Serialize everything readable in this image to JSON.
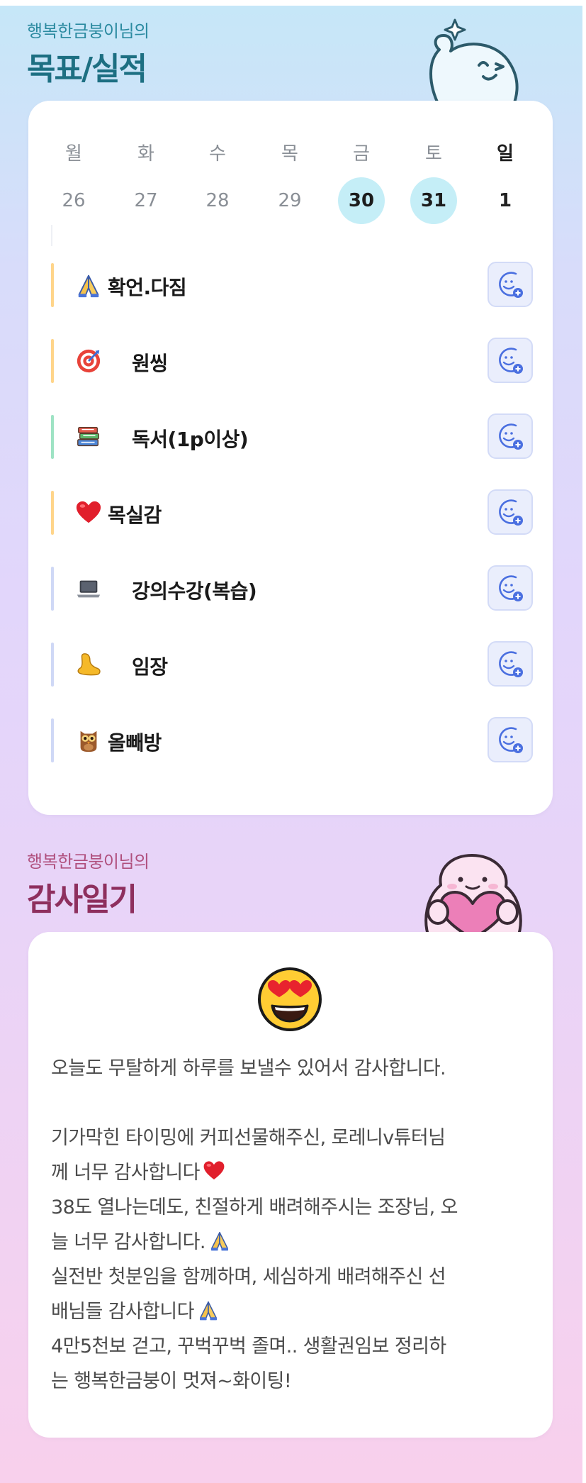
{
  "goal_section": {
    "subtitle": "행복한금붕이님의",
    "title": "목표/실적"
  },
  "calendar": {
    "weekdays": [
      "월",
      "화",
      "수",
      "목",
      "금",
      "토",
      "일"
    ],
    "dates": [
      "26",
      "27",
      "28",
      "29",
      "30",
      "31",
      "1"
    ],
    "highlighted_dates": [
      "30",
      "31"
    ]
  },
  "habits": [
    {
      "icon": "praying-hands-icon",
      "label": "확언.다짐",
      "bar_color": "#ffd58a"
    },
    {
      "icon": "target-icon",
      "label": "원씽",
      "bar_color": "#ffd58a"
    },
    {
      "icon": "books-icon",
      "label": "독서(1p이상)",
      "bar_color": "#9ee3c4"
    },
    {
      "icon": "heart-icon",
      "label": "목실감",
      "bar_color": "#ffd58a"
    },
    {
      "icon": "laptop-icon",
      "label": "강의수강(복습)",
      "bar_color": "#cfd8f6"
    },
    {
      "icon": "foot-icon",
      "label": "임장",
      "bar_color": "#cfd8f6"
    },
    {
      "icon": "owl-icon",
      "label": "올빼방",
      "bar_color": "#cfd8f6"
    }
  ],
  "diary_section": {
    "subtitle": "행복한금붕이님의",
    "title": "감사일기"
  },
  "diary": {
    "mood_icon": "heart-eyes-face-icon",
    "lines": [
      "오늘도 무탈하게 하루를 보낼수 있어서 감사합니다.",
      "",
      "기가막힌 타이밍에 커피선물해주신, 로레니v튜터님",
      "께 너무 감사합니다",
      "38도 열나는데도, 친절하게 배려해주시는 조장님, 오",
      "늘 너무 감사합니다.",
      "실전반 첫분임을 함께하며, 세심하게 배려해주신 선",
      "배님들 감사합니다",
      "4만5천보 걷고, 꾸벅꾸벅 졸며.. 생활권임보 정리하",
      "는 행복한금붕이 멋져~화이팅!"
    ]
  },
  "colors": {
    "highlight_date": "#c5eef7",
    "react_button_bg": "#eaeefc",
    "react_icon": "#4a6fe0"
  }
}
